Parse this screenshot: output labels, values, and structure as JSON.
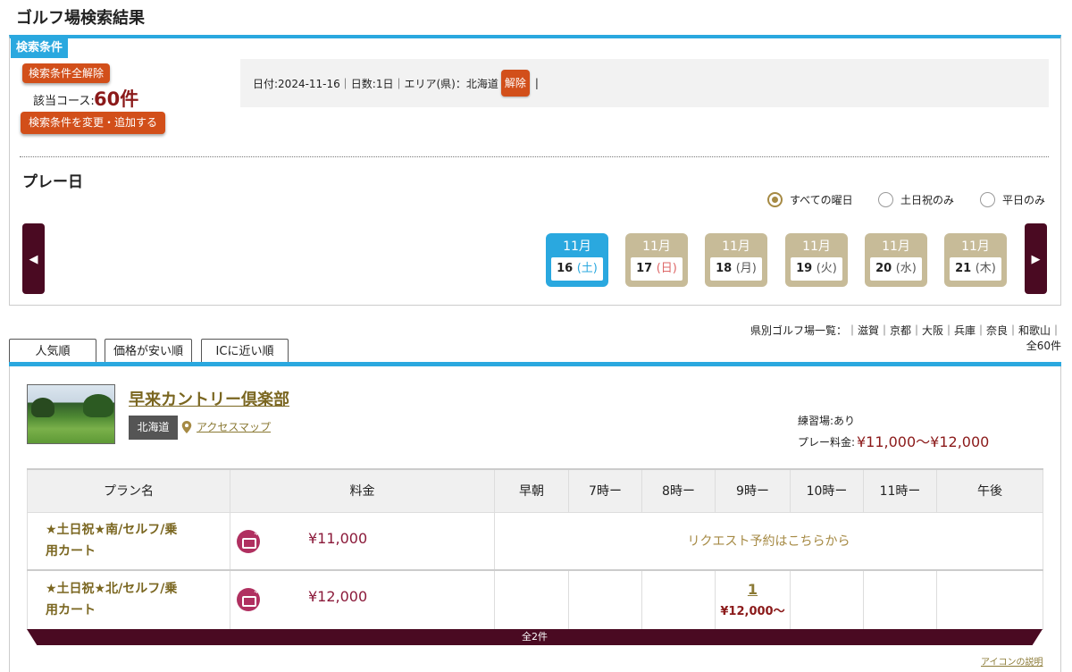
{
  "page": {
    "title": "ゴルフ場検索結果"
  },
  "conditions": {
    "tab_label": "検索条件",
    "clear_all": "検索条件全解除",
    "count_label": "該当コース:",
    "count_value": "60件",
    "change_button": "検索条件を変更・追加する",
    "summary_text": "日付:2024-11-16｜日数:1日｜エリア(県)：北海道",
    "remove_label": "解除",
    "summary_tail": "|"
  },
  "play_date": {
    "title": "プレー日",
    "filters": [
      {
        "label": "すべての曜日",
        "selected": true
      },
      {
        "label": "土日祝のみ",
        "selected": false
      },
      {
        "label": "平日のみ",
        "selected": false
      }
    ],
    "days": [
      {
        "month": "11月",
        "date": "16",
        "weekday": "(土)",
        "selected": true
      },
      {
        "month": "11月",
        "date": "17",
        "weekday": "(日)",
        "selected": false
      },
      {
        "month": "11月",
        "date": "18",
        "weekday": "(月)",
        "selected": false
      },
      {
        "month": "11月",
        "date": "19",
        "weekday": "(火)",
        "selected": false
      },
      {
        "month": "11月",
        "date": "20",
        "weekday": "(水)",
        "selected": false
      },
      {
        "month": "11月",
        "date": "21",
        "weekday": "(木)",
        "selected": false
      }
    ]
  },
  "prefecture_links": {
    "line": "県別ゴルフ場一覧：｜滋賀｜京都｜大阪｜兵庫｜奈良｜和歌山｜",
    "total": "全60件"
  },
  "sort_tabs": [
    "人気順",
    "価格が安い順",
    "ICに近い順"
  ],
  "course": {
    "name": "早来カントリー倶楽部",
    "prefecture": "北海道",
    "access_link": "アクセスマップ",
    "practice": "練習場:あり",
    "fee_label": "プレー料金:",
    "fee_value": "¥11,000〜¥12,000"
  },
  "plan_table": {
    "headers": [
      "プラン名",
      "料金",
      "早朝",
      "7時ー",
      "8時ー",
      "9時ー",
      "10時ー",
      "11時ー",
      "午後"
    ],
    "rows": [
      {
        "plan_line1": "★土日祝★南/セルフ/乗",
        "plan_line2": "用カート",
        "price": "¥11,000",
        "request": "リクエスト予約はこちらから"
      },
      {
        "plan_line1": "★土日祝★北/セルフ/乗",
        "plan_line2": "用カート",
        "price": "¥12,000",
        "slot_count": "1",
        "slot_price": "¥12,000〜"
      }
    ],
    "total": "全2件"
  },
  "footer": {
    "icon_help": "アイコンの説明"
  },
  "colors": {
    "accent_blue": "#2aa8df",
    "button_red": "#d24f1a",
    "dark_maroon": "#4a0a22",
    "gold": "#7a6620"
  }
}
